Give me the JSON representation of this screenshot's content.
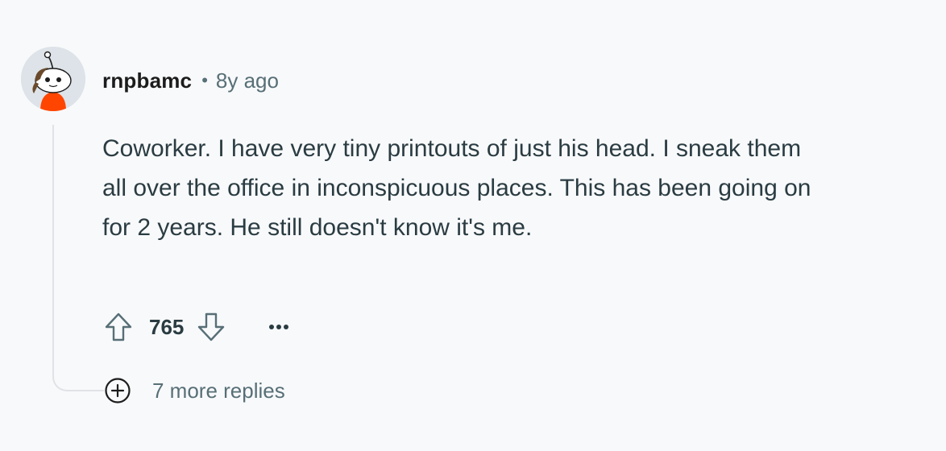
{
  "comment": {
    "author": "rnpbamc",
    "separator": "•",
    "timestamp": "8y ago",
    "body": "Coworker. I have very tiny printouts of just his head. I sneak them all over the office in inconspicuous places. This has been going on for 2 years. He still doesn't know it's me.",
    "score": "765",
    "more_replies_label": "7 more replies"
  },
  "icons": {
    "avatar": "snoo-avatar",
    "upvote": "arrow-up-outline-icon",
    "downvote": "arrow-down-outline-icon",
    "more": "ellipsis-icon",
    "expand": "plus-circle-icon"
  },
  "colors": {
    "background": "#f8f9fb",
    "text": "#2a3c42",
    "meta": "#576f76",
    "thread_line": "#dfe3e6",
    "avatar_shirt": "#ff4500"
  }
}
